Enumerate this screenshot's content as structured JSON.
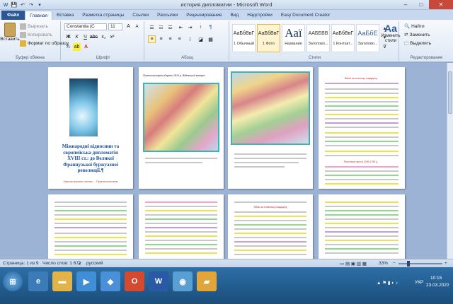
{
  "window": {
    "title": "история дипломатии - Microsoft Word",
    "min": "–",
    "max": "□",
    "close": "✕"
  },
  "qat": [
    "W",
    "💾",
    "↶",
    "↷",
    "▾"
  ],
  "tabs": [
    "Файл",
    "Главная",
    "Вставка",
    "Разметка страницы",
    "Ссылки",
    "Рассылки",
    "Рецензирование",
    "Вид",
    "Надстройки",
    "Easy Document Creator"
  ],
  "clipboard": {
    "paste": "Вставить",
    "cut": "Вырезать",
    "copy": "Копировать",
    "format": "Формат по образцу",
    "label": "Буфер обмена"
  },
  "font": {
    "name": "Constantia (С",
    "size": "11",
    "label": "Шрифт"
  },
  "paragraph": {
    "label": "Абзац"
  },
  "styles": {
    "label": "Стили",
    "items": [
      {
        "sample": "АаБбВвГ",
        "name": "1 Обычный"
      },
      {
        "sample": "АаБбВвГ",
        "name": "1 Фото"
      },
      {
        "sample": "Ааї",
        "name": "Название"
      },
      {
        "sample": "ААББВВ",
        "name": "Заголово..."
      },
      {
        "sample": "АаБбВвГ",
        "name": "1 Контакт..."
      },
      {
        "sample": "АаБбЕ",
        "name": "Заголово..."
      }
    ],
    "change": "Изменить стили"
  },
  "editing": {
    "find": "Найти",
    "replace": "Заменить",
    "select": "Выделить",
    "label": "Редактирование"
  },
  "page1": {
    "title": "Міжнародні відносини та європейська дипломатія ХVIII ст.: до Великої Французької буржуазної революції.¶",
    "sub": "Ключові питання: основні … Практичні питання"
  },
  "page3_title": "Політична карта Європи 1815 р. Віденський конгрес",
  "page5_heading": "Війни за польську спадщину",
  "page8_heading": "Політичне життя 1789-1795 р.",
  "page12_title": "Війни за Іспанську спадщину",
  "status": {
    "page": "Страница: 1 из 9",
    "words": "Число слов: 1 671",
    "lang": "русский",
    "zoom": "33%"
  },
  "taskbar": {
    "lang": "УКР",
    "time": "10:15",
    "date": "23.03.2020"
  }
}
